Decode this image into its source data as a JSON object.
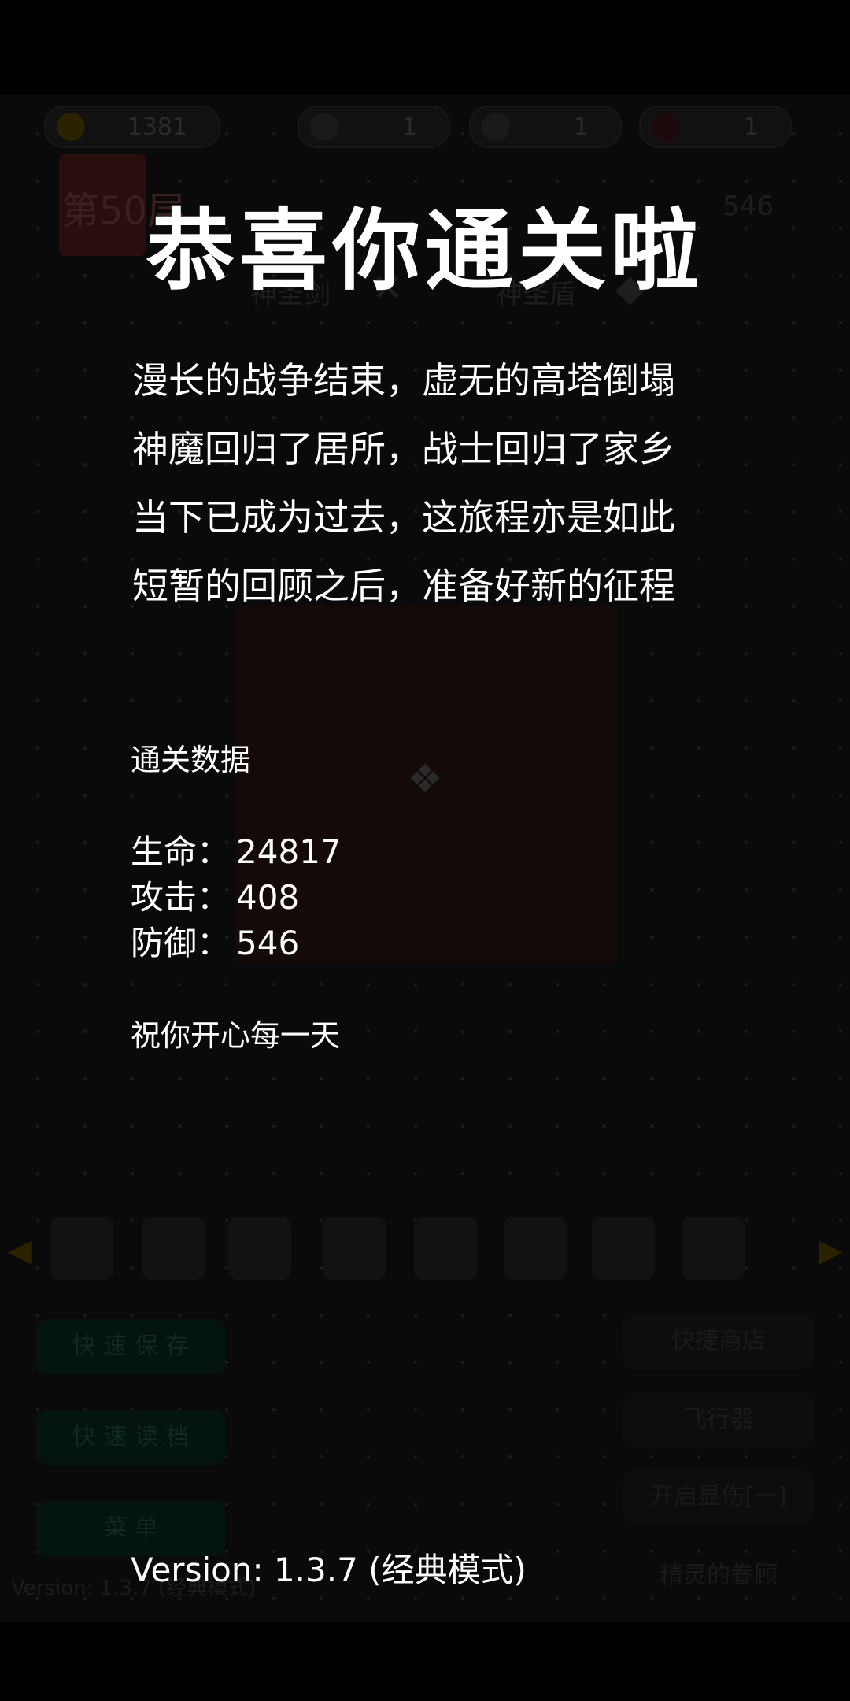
{
  "hud": {
    "gold": "1381",
    "key_yellow": "1",
    "key_blue": "1",
    "key_red": "1",
    "floor": "第50层",
    "defense_display": "546",
    "weapon": "神圣剑",
    "shield": "神圣盾"
  },
  "buttons": {
    "quick_save": "快 速 保 存",
    "quick_load": "快 速 读 档",
    "menu": "菜  单",
    "quick_shop": "快捷商店",
    "fly": "飞行器",
    "damage_toggle": "开启显伤[一]",
    "spirit": "精灵的眷顾"
  },
  "ghost_version": "Version: 1.3.7 (经典模式)",
  "ending": {
    "title": "恭喜你通关啦",
    "story": [
      "漫长的战争结束，虚无的高塔倒塌",
      "神魔回归了居所，战士回归了家乡",
      "当下已成为过去，这旅程亦是如此",
      "短暂的回顾之后，准备好新的征程"
    ],
    "stats_heading": "通关数据",
    "stats": {
      "hp_label": "生命",
      "hp": "24817",
      "atk_label": "攻击",
      "atk": "408",
      "def_label": "防御",
      "def": "546"
    },
    "wish": "祝你开心每一天",
    "version": "Version: 1.3.7 (经典模式)"
  },
  "colors": {
    "background": "#000000",
    "text": "#ffffff"
  }
}
